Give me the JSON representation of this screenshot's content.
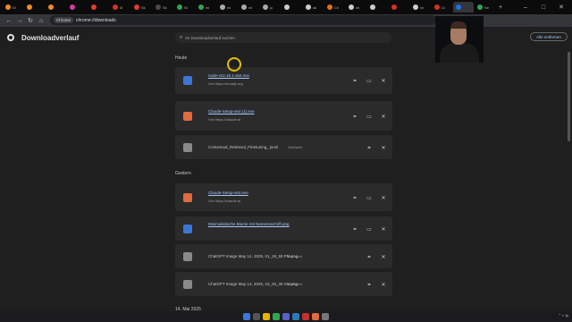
{
  "tabs": [
    {
      "label": "Di",
      "color": "#f28b22"
    },
    {
      "label": "",
      "color": "#f28b22"
    },
    {
      "label": "",
      "color": "#f28b22"
    },
    {
      "label": "",
      "color": "#d63ca4"
    },
    {
      "label": "",
      "color": "#e33b2e"
    },
    {
      "label": "M",
      "color": "#d93025"
    },
    {
      "label": "Sk",
      "color": "#e33b2e"
    },
    {
      "label": "Sk",
      "color": "#4a4a4a"
    },
    {
      "label": "Ni",
      "color": "#2fa84f"
    },
    {
      "label": "mi",
      "color": "#2fa84f"
    },
    {
      "label": "mi",
      "color": "#aaaaaa"
    },
    {
      "label": "mi",
      "color": "#aaaaaa"
    },
    {
      "label": "jo",
      "color": "#aaaaaa"
    },
    {
      "label": "",
      "color": "#cccccc"
    },
    {
      "label": "ak",
      "color": "#cccccc"
    },
    {
      "label": "Ch",
      "color": "#e8710a"
    },
    {
      "label": "mi",
      "color": "#cccccc"
    },
    {
      "label": "",
      "color": "#cccccc"
    },
    {
      "label": "",
      "color": "#d93025"
    },
    {
      "label": "ne",
      "color": "#cccccc"
    },
    {
      "label": "Ul",
      "color": "#d93025"
    },
    {
      "label": "",
      "color": "#1a73e8"
    },
    {
      "label": "Ne",
      "color": "#2fa84f"
    }
  ],
  "address": {
    "chip": "Chrome",
    "url": "chrome://downloads"
  },
  "page": {
    "title": "Downloadverlauf",
    "search_placeholder": "Im Downloadverlauf suchen",
    "clear_all": "Alle entfernen"
  },
  "sections": {
    "today": "Heute",
    "yesterday": "Gestern",
    "older": "14. Mai 2025"
  },
  "downloads": [
    {
      "name": "node-v22.15.1-x64.msi",
      "source": "Von https://nodejs.org",
      "icon": "node-installer-icon",
      "color": "#3c76d8",
      "link": true
    },
    {
      "name": "Claude-Setup-x64 (1).exe",
      "source": "Von https://claude.ai",
      "icon": "claude-icon",
      "color": "#e06b3c",
      "link": true
    },
    {
      "name": "Contextual_Retrieval_Finetuning_ jsonl",
      "source": "Gelöscht",
      "icon": "file-icon",
      "color": "#8a8a8a",
      "link": false
    },
    {
      "name": "Claude-Setup-x64.exe",
      "source": "Von https://claude.ai",
      "icon": "claude-icon",
      "color": "#e06b3c",
      "link": true
    },
    {
      "name": "Minimalistische Blume mit Namensschrift.png",
      "source": "",
      "icon": "image-file-icon",
      "color": "#3c76d8",
      "link": true
    },
    {
      "name": "ChatGPT Image May 14, 2025, 01_19_50 PM.png",
      "source": "Gelöscht",
      "icon": "file-icon",
      "color": "#8a8a8a",
      "link": false
    },
    {
      "name": "ChatGPT Image May 14, 2025, 10_33_30 AM.png",
      "source": "Gelöscht",
      "icon": "file-icon",
      "color": "#8a8a8a",
      "link": false
    }
  ]
}
